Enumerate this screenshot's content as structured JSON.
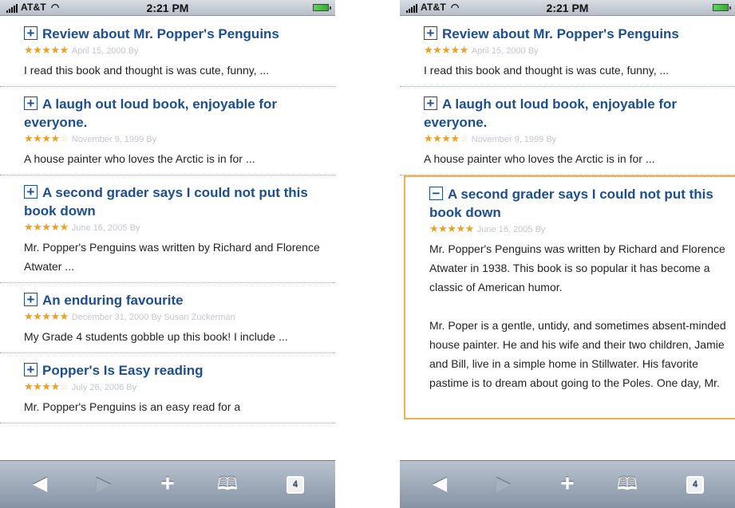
{
  "status": {
    "carrier": "AT&T",
    "time": "2:21 PM"
  },
  "icons": {
    "signal": "signal-bars-icon",
    "wifi": "wifi-icon",
    "battery": "battery-icon",
    "toggle_plus": "plus-square-icon",
    "toggle_minus": "minus-square-icon",
    "back": "back-arrow-icon",
    "forward": "forward-arrow-icon",
    "add": "plus-icon",
    "bookmarks": "open-book-icon",
    "pages": "pages-icon"
  },
  "toolbar": {
    "pages_count": "4"
  },
  "left": {
    "reviews": [
      {
        "toggle": "+",
        "title": "Review about Mr. Popper's Penguins",
        "stars": "★★★★★",
        "stars_empty": "",
        "meta": "April 15, 2000 By",
        "body": "I read this book and thought is was cute, funny, ..."
      },
      {
        "toggle": "+",
        "title": "A laugh out loud book, enjoyable for everyone.",
        "stars": "★★★★",
        "stars_empty": "☆",
        "meta": "November 9, 1999 By",
        "body": "A house painter who loves the Arctic is in for ..."
      },
      {
        "toggle": "+",
        "title": "A second grader says I could not put this book down",
        "stars": "★★★★★",
        "stars_empty": "",
        "meta": "June 16, 2005 By",
        "body": "Mr. Popper's Penguins was written by Richard and Florence Atwater ..."
      },
      {
        "toggle": "+",
        "title": "An enduring favourite",
        "stars": "★★★★★",
        "stars_empty": "",
        "meta": "December 31, 2000 By Susan Zuckerman",
        "body": "My Grade 4 students gobble up this book! I include ..."
      },
      {
        "toggle": "+",
        "title": "Popper's Is Easy reading",
        "stars": "★★★★",
        "stars_empty": "☆",
        "meta": "July 26, 2006 By",
        "body": "Mr. Popper's Penguins is an easy read for a"
      }
    ]
  },
  "right": {
    "reviews": [
      {
        "toggle": "+",
        "title": "Review about Mr. Popper's Penguins",
        "stars": "★★★★★",
        "stars_empty": "",
        "meta": "April 15, 2000 By",
        "body": "I read this book and thought is was cute, funny, ..."
      },
      {
        "toggle": "+",
        "title": "A laugh out loud book, enjoyable for everyone.",
        "stars": "★★★★",
        "stars_empty": "☆",
        "meta": "November 9, 1999 By",
        "body": "A house painter who loves the Arctic is in for ..."
      },
      {
        "toggle": "−",
        "title": "A second grader says I could not put this book down",
        "stars": "★★★★★",
        "stars_empty": "",
        "meta": "June 16, 2005 By",
        "body": "Mr. Popper's Penguins was written by Richard and Florence Atwater in 1938. This book is so popular it has become a classic of American humor.",
        "body2": "Mr. Poper is a gentle, untidy, and sometimes absent-minded house painter. He and his wife and their two children, Jamie and Bill, live in a simple home in Stillwater. His favorite pastime is to dream about going to the Poles. One day, Mr."
      }
    ]
  }
}
